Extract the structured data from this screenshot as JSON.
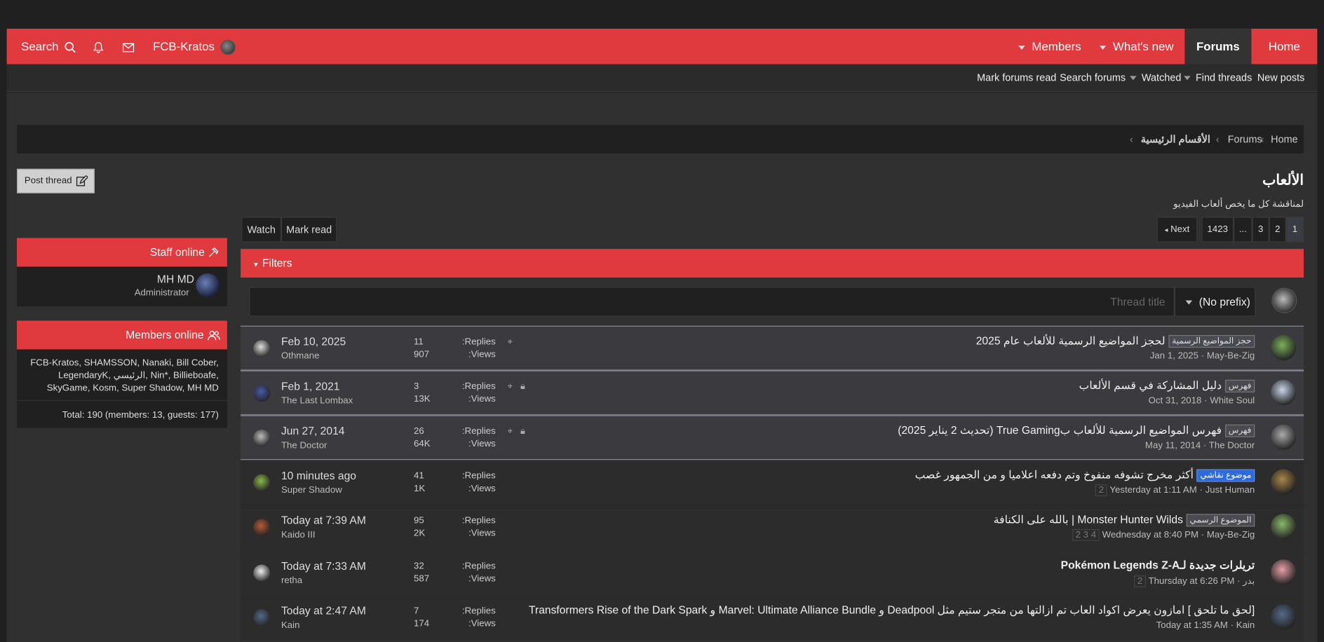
{
  "nav": {
    "search_label": "Search",
    "user_label": "FCB-Kratos",
    "members": "Members",
    "whats_new": "What's new",
    "forums": "Forums",
    "home": "Home"
  },
  "subnav": {
    "mark_forums_read": "Mark forums read",
    "search_forums": "Search forums",
    "watched": "Watched",
    "find_threads": "Find threads",
    "new_posts": "New posts"
  },
  "breadcrumb": {
    "home": "Home",
    "forums": "Forums",
    "section": "الأقسام الرئيسية"
  },
  "forum": {
    "title": "الألعاب",
    "description": "لمناقشة كل ما يخص ألعاب الفيديو"
  },
  "buttons": {
    "post_thread": "Post thread",
    "watch": "Watch",
    "mark_read": "Mark read"
  },
  "pagination": {
    "next": "Next",
    "pages": [
      "1423",
      "...",
      "3",
      "2",
      "1"
    ]
  },
  "filters": {
    "label": "Filters",
    "title_placeholder": "Thread title",
    "prefix": "(No prefix)"
  },
  "labels": {
    "replies": "Replies:",
    "views": "Views:"
  },
  "threads": [
    {
      "prefix": "حجز المواضيع الرسمية",
      "prefix_style": "gray",
      "title": "لحجز المواضيع الرسمية للألعاب عام 2025",
      "date": "Jan 1, 2025",
      "author": "May-Be-Zig",
      "replies": "11",
      "views": "907",
      "last_date": "Feb 10, 2025",
      "last_user": "Othmane",
      "sticky": true,
      "locked": false,
      "pages": ""
    },
    {
      "prefix": "فهرس",
      "prefix_style": "gray",
      "title": "دليل المشاركة في قسم الألعاب",
      "date": "Oct 31, 2018",
      "author": "White Soul",
      "replies": "3",
      "views": "13K",
      "last_date": "Feb 1, 2021",
      "last_user": "The Last Lombax",
      "sticky": true,
      "locked": true,
      "pages": ""
    },
    {
      "prefix": "فهرس",
      "prefix_style": "gray",
      "title": "فهرس المواضيع الرسمية للألعاب بTrue Gaming (تحديث 2 يناير 2025)",
      "date": "May 11, 2014",
      "author": "The Doctor",
      "replies": "26",
      "views": "64K",
      "last_date": "Jun 27, 2014",
      "last_user": "The Doctor",
      "sticky": true,
      "locked": true,
      "pages": ""
    },
    {
      "prefix": "موضوع نقاشي",
      "prefix_style": "blue",
      "title": "أكثر مخرج تشوفه منفوخ وتم دفعه اعلاميا و من الجمهور غصب",
      "date": "Yesterday at 1:11 AM",
      "author": "Just Human",
      "replies": "41",
      "views": "1K",
      "last_date": "10 minutes ago",
      "last_user": "Super Shadow",
      "sticky": false,
      "locked": false,
      "pages": "2"
    },
    {
      "prefix": "الموضوع الرسمي",
      "prefix_style": "gray",
      "title": "Monster Hunter Wilds | بالله على الكنافة",
      "date": "Wednesday at 8:40 PM",
      "author": "May-Be-Zig",
      "replies": "95",
      "views": "2K",
      "last_date": "Today at 7:39 AM",
      "last_user": "Kaido III",
      "sticky": false,
      "locked": false,
      "pages": "2 3 4"
    },
    {
      "prefix": "",
      "prefix_style": "gray",
      "title": "تريلرات جديدة لـPokémon Legends Z-A",
      "date": "Thursday at 6:26 PM",
      "author": "بدر",
      "replies": "32",
      "views": "587",
      "last_date": "Today at 7:33 AM",
      "last_user": "retha",
      "sticky": false,
      "locked": false,
      "pages": "2"
    },
    {
      "prefix": "",
      "prefix_style": "gray",
      "title": "[لحق ما تلحق ] امازون يعرض اكواد العاب تم ازالتها من متجر ستيم مثل Deadpool و Marvel: Ultimate Alliance Bundle و Transformers Rise of the Dark Spark",
      "date": "Today at 1:35 AM",
      "author": "Kain",
      "replies": "7",
      "views": "174",
      "last_date": "Today at 2:47 AM",
      "last_user": "Kain",
      "sticky": false,
      "locked": false,
      "pages": ""
    }
  ],
  "staff": {
    "heading": "Staff online",
    "name": "MH MD",
    "role": "Administrator"
  },
  "members": {
    "heading": "Members online",
    "line1": "FCB-Kratos, SHAMSSON, Nanaki, Bill Cober,",
    "line2": "LegendaryK, الرئيسي, Nin*, Billieboafe,",
    "line3": "SkyGame, Kosm, Super Shadow, MH MD",
    "total": "Total: 190 (members: 13, guests: 177)"
  },
  "colors": {
    "accent": "#e13a3e",
    "background": "#202020",
    "panel": "#303030",
    "prefix_blue": "#2f6ad9"
  },
  "icons": {
    "search": "search-icon",
    "bell": "bell-icon",
    "mail": "envelope-icon",
    "pin": "pin-icon",
    "lock": "lock-icon",
    "edit": "edit-icon",
    "users": "users-icon"
  }
}
